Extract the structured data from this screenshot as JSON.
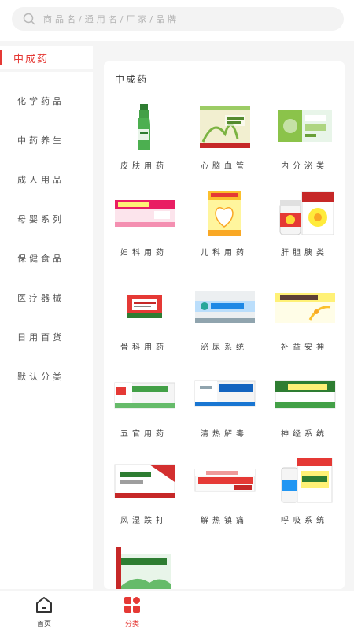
{
  "search": {
    "placeholder": "商品名/通用名/厂家/品牌"
  },
  "category_header": "中成药",
  "sidebar": {
    "items": [
      {
        "label": "化学药品"
      },
      {
        "label": "中药养生"
      },
      {
        "label": "成人用品"
      },
      {
        "label": "母婴系列"
      },
      {
        "label": "保健食品"
      },
      {
        "label": "医疗器械"
      },
      {
        "label": "日用百货"
      },
      {
        "label": "默认分类"
      }
    ]
  },
  "panel": {
    "title": "中成药",
    "items": [
      {
        "label": "皮肤用药",
        "icon": "green-bottle-icon"
      },
      {
        "label": "心脑血管",
        "icon": "shenmai-injection-box-icon"
      },
      {
        "label": "内分泌类",
        "icon": "green-box-icon"
      },
      {
        "label": "妇科用药",
        "icon": "pink-gel-box-icon"
      },
      {
        "label": "儿科用药",
        "icon": "yellow-granule-box-icon"
      },
      {
        "label": "肝胆胰类",
        "icon": "hugan-tablet-bottle-icon"
      },
      {
        "label": "骨科用药",
        "icon": "red-ointment-box-icon"
      },
      {
        "label": "泌尿系统",
        "icon": "blue-capsule-box-icon"
      },
      {
        "label": "补益安神",
        "icon": "yellow-injection-box-icon"
      },
      {
        "label": "五官用药",
        "icon": "green-tablet-box-icon"
      },
      {
        "label": "清热解毒",
        "icon": "blue-injection-box-icon"
      },
      {
        "label": "神经系统",
        "icon": "green-injection-box-icon"
      },
      {
        "label": "风湿跌打",
        "icon": "red-white-box-icon"
      },
      {
        "label": "解热镇痛",
        "icon": "red-stripe-box-icon"
      },
      {
        "label": "呼吸系统",
        "icon": "yellow-bottle-box-icon"
      },
      {
        "label": "",
        "icon": "huoxiang-liquid-box-icon"
      }
    ]
  },
  "tabbar": {
    "home_label": "首页",
    "category_label": "分类"
  },
  "colors": {
    "accent": "#e53935",
    "background": "#f5f5f5"
  }
}
